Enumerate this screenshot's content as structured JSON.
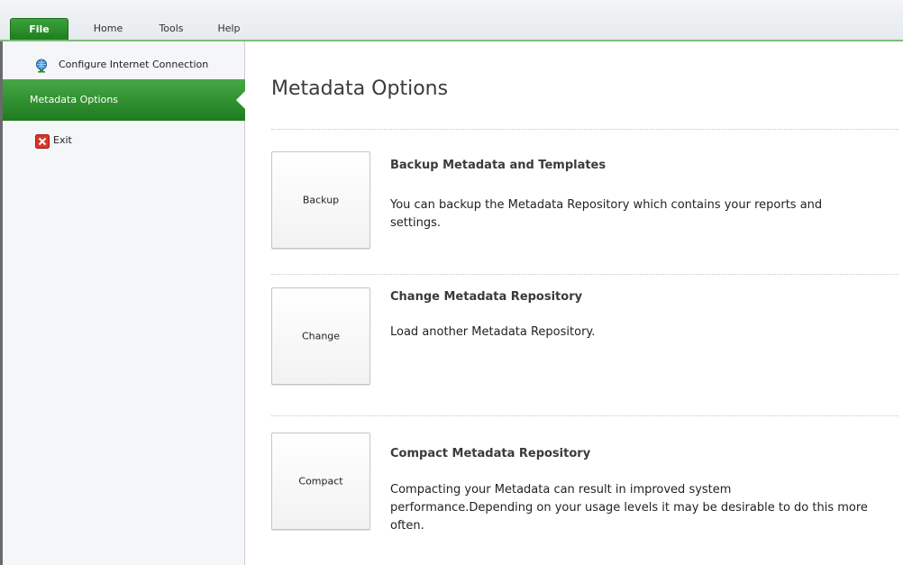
{
  "tabs": {
    "file": "File",
    "home": "Home",
    "tools": "Tools",
    "help": "Help"
  },
  "sidebar": {
    "items": [
      {
        "label": "Configure Internet Connection",
        "icon": "globe-icon"
      },
      {
        "label": "Metadata Options",
        "selected": true
      },
      {
        "label": "Exit",
        "icon": "exit-icon"
      }
    ]
  },
  "main": {
    "title": "Metadata Options",
    "options": [
      {
        "button": "Backup",
        "heading": "Backup Metadata and Templates",
        "description": "You can backup the Metadata Repository which contains your reports and settings."
      },
      {
        "button": "Change",
        "heading": "Change Metadata Repository",
        "description": "Load another Metadata Repository."
      },
      {
        "button": "Compact",
        "heading": "Compact Metadata Repository",
        "description": "Compacting your Metadata can result in improved system performance.Depending on your usage levels it may be desirable to do this more often."
      }
    ]
  },
  "colors": {
    "accent": "#2e8b2e",
    "selected_bg": "#1e7b1e",
    "tab_underline": "#7bbd7b"
  }
}
